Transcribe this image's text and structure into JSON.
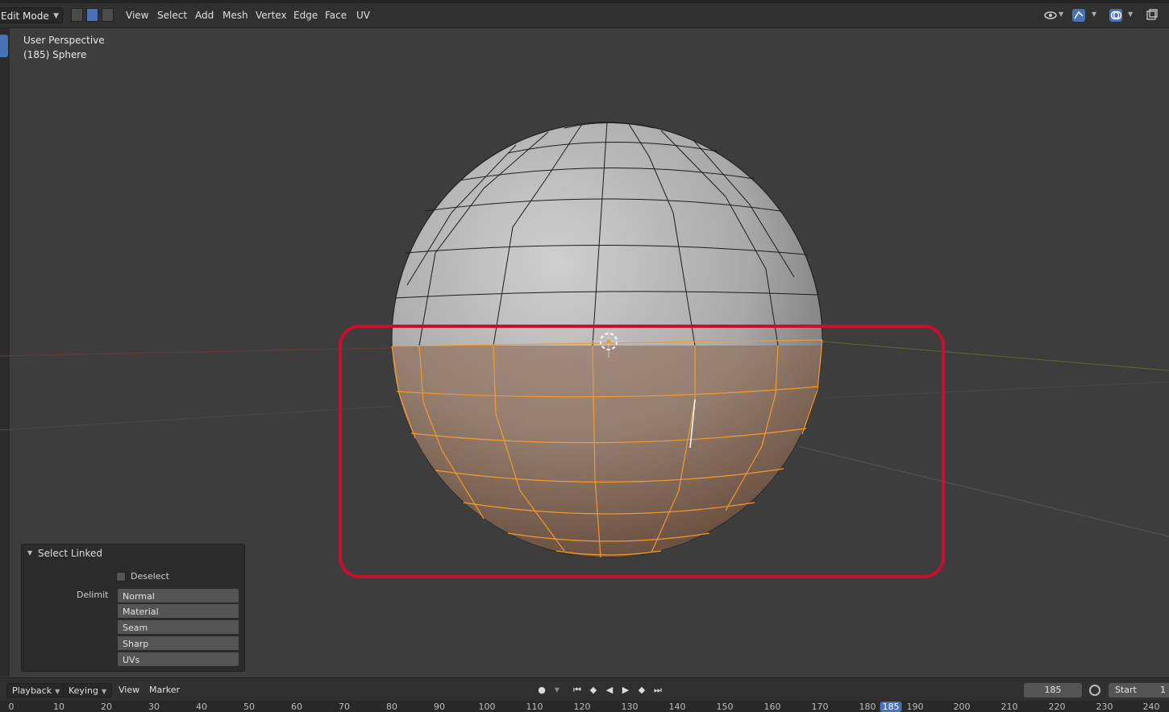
{
  "header": {
    "mode": "Edit Mode",
    "menus": [
      "View",
      "Select",
      "Add",
      "Mesh",
      "Vertex",
      "Edge",
      "Face",
      "UV"
    ]
  },
  "viewport": {
    "perspective": "User Perspective",
    "object": "(185) Sphere"
  },
  "operator_panel": {
    "title": "Select Linked",
    "deselect_label": "Deselect",
    "deselect_checked": false,
    "delimit_label": "Delimit",
    "delimit_options": [
      "Normal",
      "Material",
      "Seam",
      "Sharp",
      "UVs"
    ]
  },
  "timeline": {
    "playback": "Playback",
    "keying": "Keying",
    "view": "View",
    "marker": "Marker",
    "current_frame": "185",
    "start_label": "Start",
    "start_value": "1",
    "ruler_labels": [
      "0",
      "10",
      "20",
      "30",
      "40",
      "50",
      "60",
      "70",
      "80",
      "90",
      "100",
      "110",
      "120",
      "130",
      "140",
      "150",
      "160",
      "170",
      "180",
      "185",
      "190",
      "200",
      "210",
      "220",
      "230",
      "240"
    ]
  },
  "colors": {
    "selection_orange": "#f29a2e",
    "highlight_box": "#c8102e",
    "accent_blue": "#4772b3"
  }
}
